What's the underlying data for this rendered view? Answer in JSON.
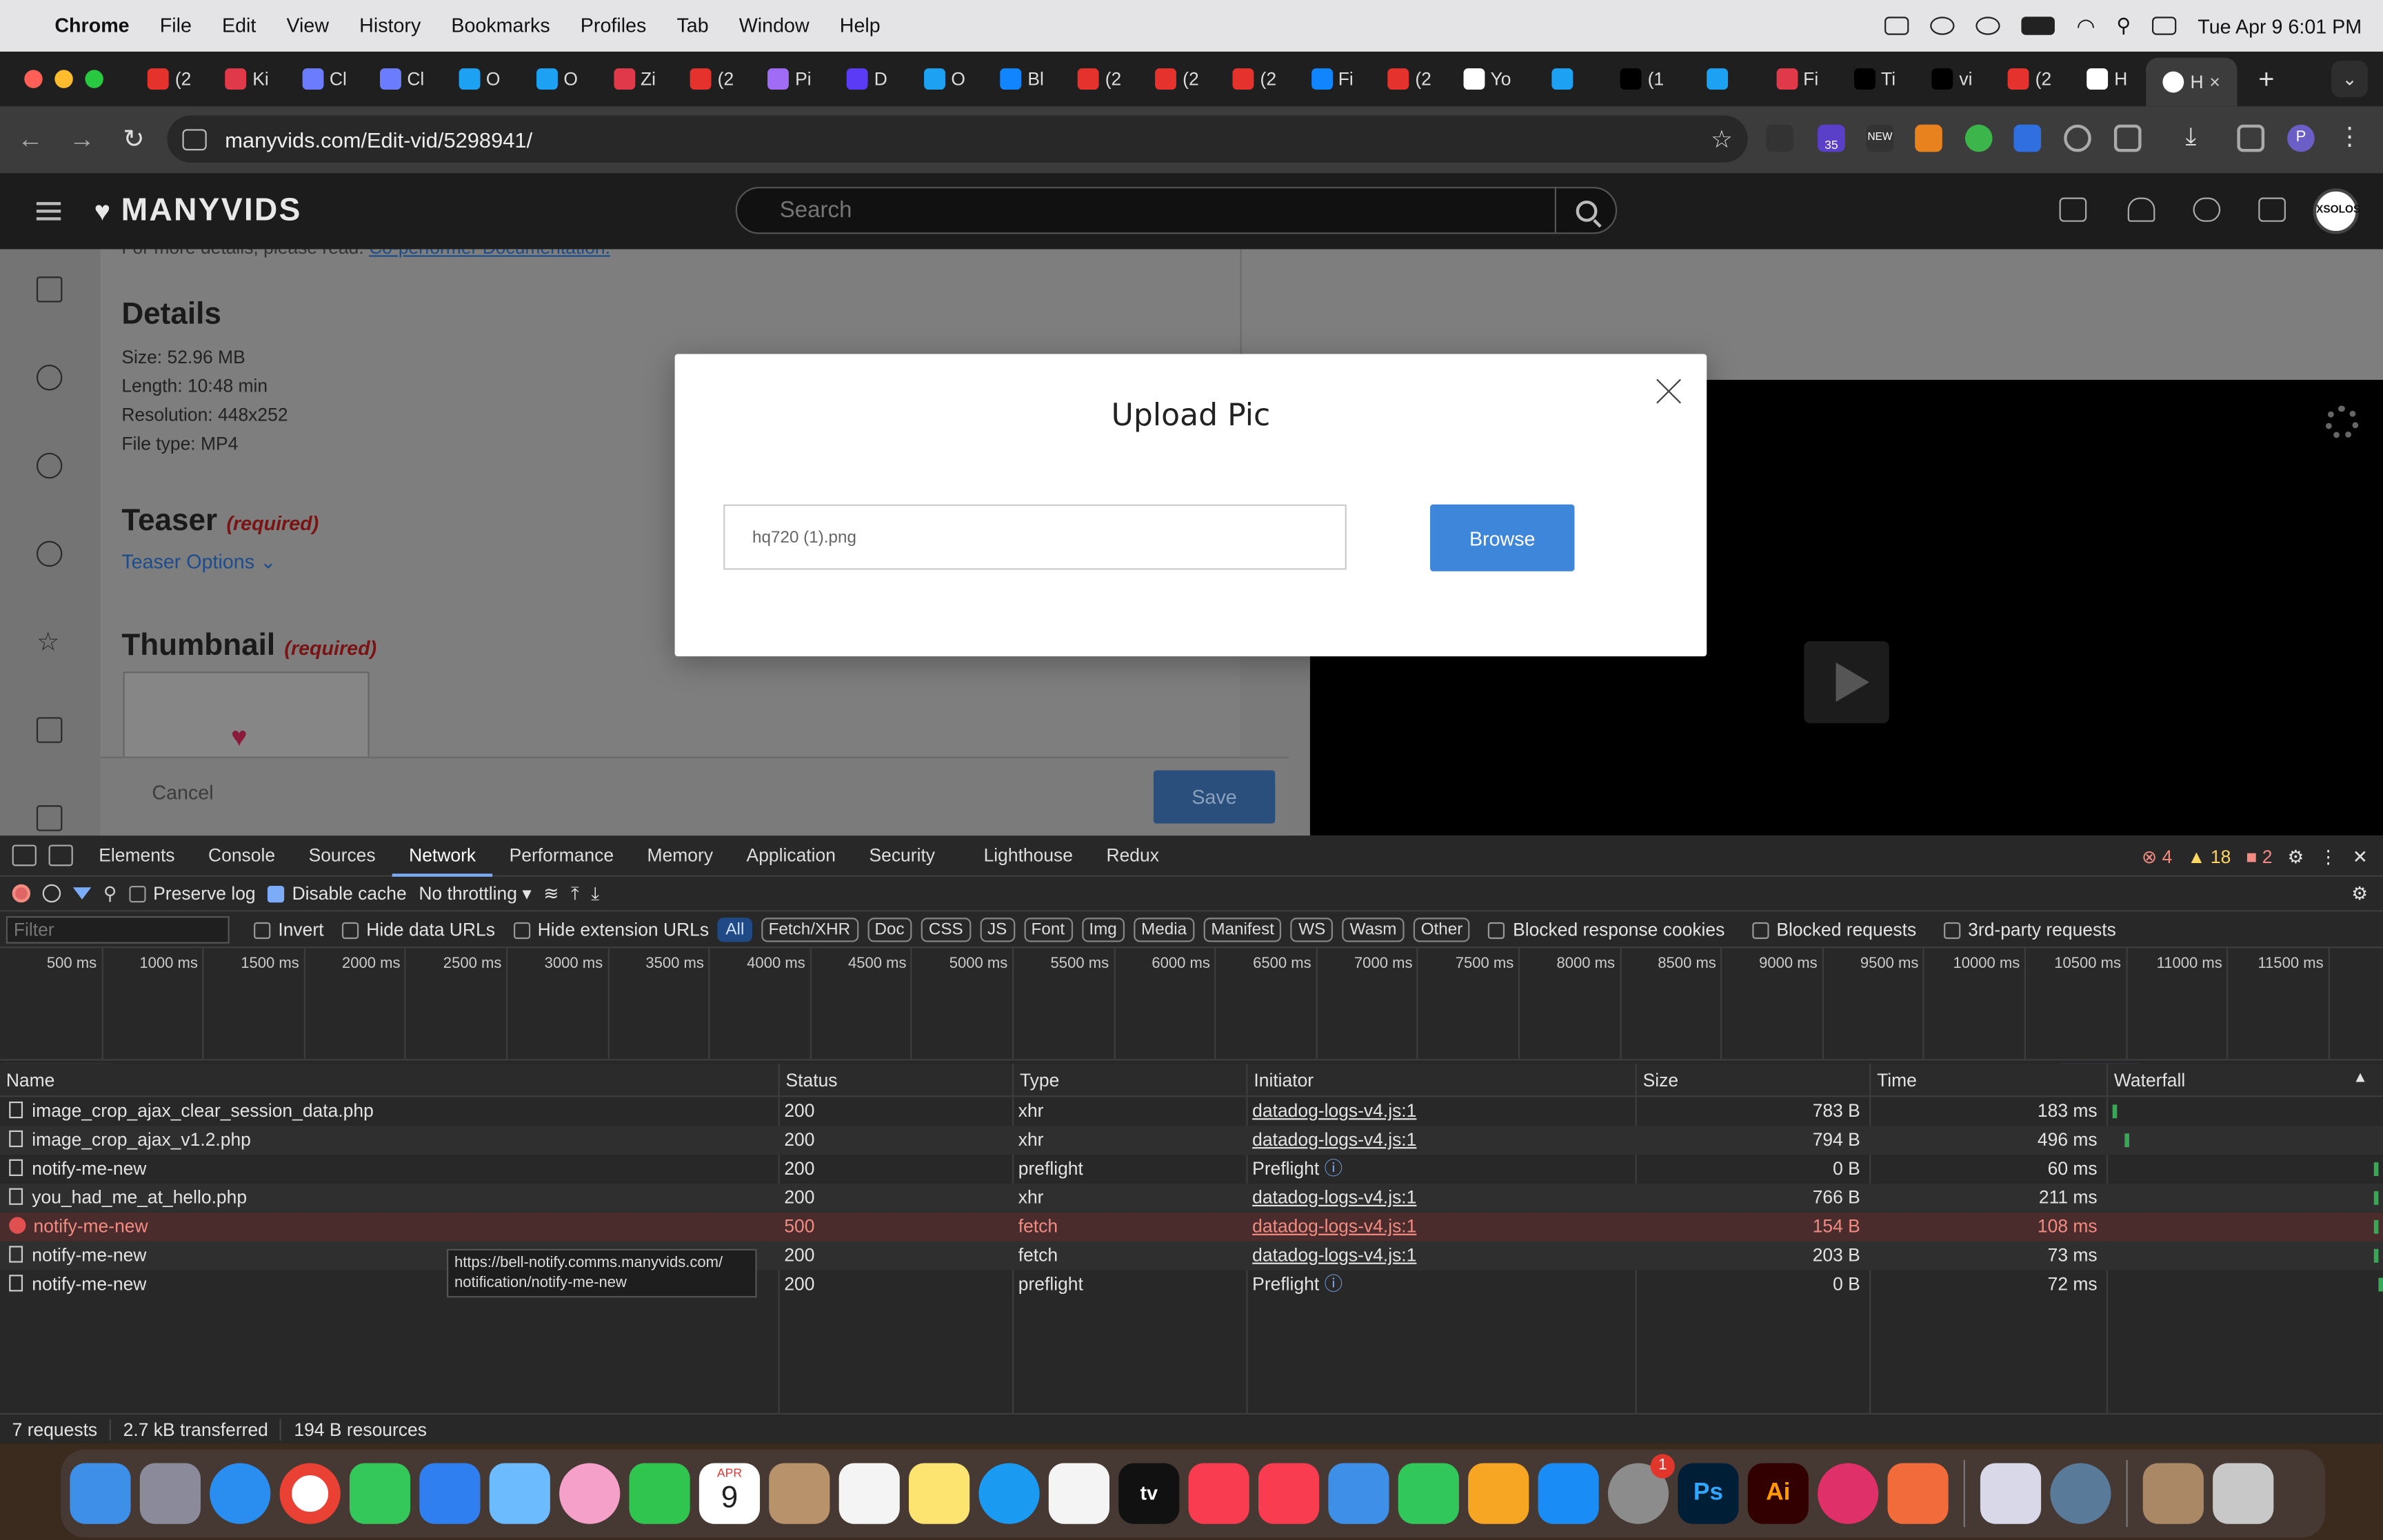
{
  "menubar": {
    "app_name": "Chrome",
    "items": [
      "File",
      "Edit",
      "View",
      "History",
      "Bookmarks",
      "Profiles",
      "Tab",
      "Window",
      "Help"
    ],
    "datetime": "Tue Apr 9  6:01 PM"
  },
  "browser": {
    "tabs": [
      {
        "label": "(2",
        "color": "#e5322d"
      },
      {
        "label": "Ki",
        "color": "#e03a4a"
      },
      {
        "label": "Cl",
        "color": "#6b7cff"
      },
      {
        "label": "Cl",
        "color": "#6b7cff"
      },
      {
        "label": "O",
        "color": "#1da1f2"
      },
      {
        "label": "O",
        "color": "#1da1f2"
      },
      {
        "label": "Zi",
        "color": "#e03a4a"
      },
      {
        "label": "(2",
        "color": "#e5322d"
      },
      {
        "label": "Pi",
        "color": "#a06cf5"
      },
      {
        "label": "D",
        "color": "#5b3bf5"
      },
      {
        "label": "O",
        "color": "#1da1f2"
      },
      {
        "label": "Bl",
        "color": "#1185fe"
      },
      {
        "label": "(2",
        "color": "#e5322d"
      },
      {
        "label": "(2",
        "color": "#e5322d"
      },
      {
        "label": "(2",
        "color": "#e5322d"
      },
      {
        "label": "Fi",
        "color": "#1185fe"
      },
      {
        "label": "(2",
        "color": "#e5322d"
      },
      {
        "label": "Yo",
        "color": "#ffffff"
      },
      {
        "label": "",
        "color": "#1da1f2"
      },
      {
        "label": "(1",
        "color": "#000000"
      },
      {
        "label": "",
        "color": "#1da1f2"
      },
      {
        "label": "Fi",
        "color": "#e03a4a"
      },
      {
        "label": "Ti",
        "color": "#000000"
      },
      {
        "label": "vi",
        "color": "#000000"
      },
      {
        "label": "(2",
        "color": "#e5322d"
      },
      {
        "label": "H",
        "color": "#ffffff"
      }
    ],
    "active_tab": {
      "label": "H",
      "close": "×"
    },
    "new_tab": "+",
    "url": "manyvids.com/Edit-vid/5298941/",
    "ext_badge": "35",
    "ext_new": "NEW",
    "profile_initial": "P"
  },
  "site": {
    "logo": "MANYVIDS",
    "search_placeholder": "Search",
    "avatar_text": "XSOLOS"
  },
  "edit_page": {
    "doc_link_prefix": "For more details, please read:",
    "doc_link": "Co-performer Documentation.",
    "details_heading": "Details",
    "size_label": "Size:",
    "size_value": "52.96 MB",
    "length_label": "Length:",
    "length_value": "10:48 min",
    "resolution_label": "Resolution:",
    "resolution_value": "448x252",
    "filetype_label": "File type:",
    "filetype_value": "MP4",
    "teaser_heading": "Teaser",
    "teaser_required": "(required)",
    "teaser_options": "Teaser Options ⌄",
    "thumbnail_heading": "Thumbnail",
    "thumbnail_required": "(required)",
    "cancel_label": "Cancel",
    "save_label": "Save"
  },
  "modal": {
    "title": "Upload Pic",
    "file_value": "hq720 (1).png",
    "browse_label": "Browse"
  },
  "devtools": {
    "tabs": [
      "Elements",
      "Console",
      "Sources",
      "Network",
      "Performance",
      "Memory",
      "Application",
      "Security",
      "Lighthouse",
      "Redux"
    ],
    "active_tab": "Network",
    "errors": "4",
    "warnings": "18",
    "issues": "2",
    "preserve_log": "Preserve log",
    "disable_cache": "Disable cache",
    "throttling": "No throttling",
    "filter_placeholder": "Filter",
    "invert": "Invert",
    "hide_data_urls": "Hide data URLs",
    "hide_extension_urls": "Hide extension URLs",
    "type_filters": [
      "All",
      "Fetch/XHR",
      "Doc",
      "CSS",
      "JS",
      "Font",
      "Img",
      "Media",
      "Manifest",
      "WS",
      "Wasm",
      "Other"
    ],
    "blocked_cookies": "Blocked response cookies",
    "blocked_requests": "Blocked requests",
    "third_party": "3rd-party requests",
    "timeline_ticks": [
      "500 ms",
      "1000 ms",
      "1500 ms",
      "2000 ms",
      "2500 ms",
      "3000 ms",
      "3500 ms",
      "4000 ms",
      "4500 ms",
      "5000 ms",
      "5500 ms",
      "6000 ms",
      "6500 ms",
      "7000 ms",
      "7500 ms",
      "8000 ms",
      "8500 ms",
      "9000 ms",
      "9500 ms",
      "10000 ms",
      "10500 ms",
      "11000 ms",
      "11500 ms",
      "1"
    ],
    "columns": [
      "Name",
      "Status",
      "Type",
      "Initiator",
      "Size",
      "Time",
      "Waterfall"
    ],
    "requests": [
      {
        "name": "image_crop_ajax_clear_session_data.php",
        "status": "200",
        "type": "xhr",
        "initiator": "datadog-logs-v4.js:1",
        "size": "783 B",
        "time": "183 ms",
        "error": false
      },
      {
        "name": "image_crop_ajax_v1.2.php",
        "status": "200",
        "type": "xhr",
        "initiator": "datadog-logs-v4.js:1",
        "size": "794 B",
        "time": "496 ms",
        "error": false
      },
      {
        "name": "notify-me-new",
        "status": "200",
        "type": "preflight",
        "initiator": "Preflight",
        "size": "0 B",
        "time": "60 ms",
        "error": false
      },
      {
        "name": "you_had_me_at_hello.php",
        "status": "200",
        "type": "xhr",
        "initiator": "datadog-logs-v4.js:1",
        "size": "766 B",
        "time": "211 ms",
        "error": false
      },
      {
        "name": "notify-me-new",
        "status": "500",
        "type": "fetch",
        "initiator": "datadog-logs-v4.js:1",
        "size": "154 B",
        "time": "108 ms",
        "error": true
      },
      {
        "name": "notify-me-new",
        "status": "200",
        "type": "fetch",
        "initiator": "datadog-logs-v4.js:1",
        "size": "203 B",
        "time": "73 ms",
        "error": false
      },
      {
        "name": "notify-me-new",
        "status": "200",
        "type": "preflight",
        "initiator": "Preflight",
        "size": "0 B",
        "time": "72 ms",
        "error": false
      }
    ],
    "tooltip_line1": "https://bell-notify.comms.manyvids.com/",
    "tooltip_line2": "notification/notify-me-new",
    "footer_requests": "7 requests",
    "footer_transferred": "2.7 kB transferred",
    "footer_resources": "194 B resources"
  },
  "dock": {
    "calendar_month": "APR",
    "calendar_day": "9",
    "settings_badge": "1",
    "ps_label": "Ps",
    "ai_label": "Ai",
    "tv_label": "tv"
  }
}
